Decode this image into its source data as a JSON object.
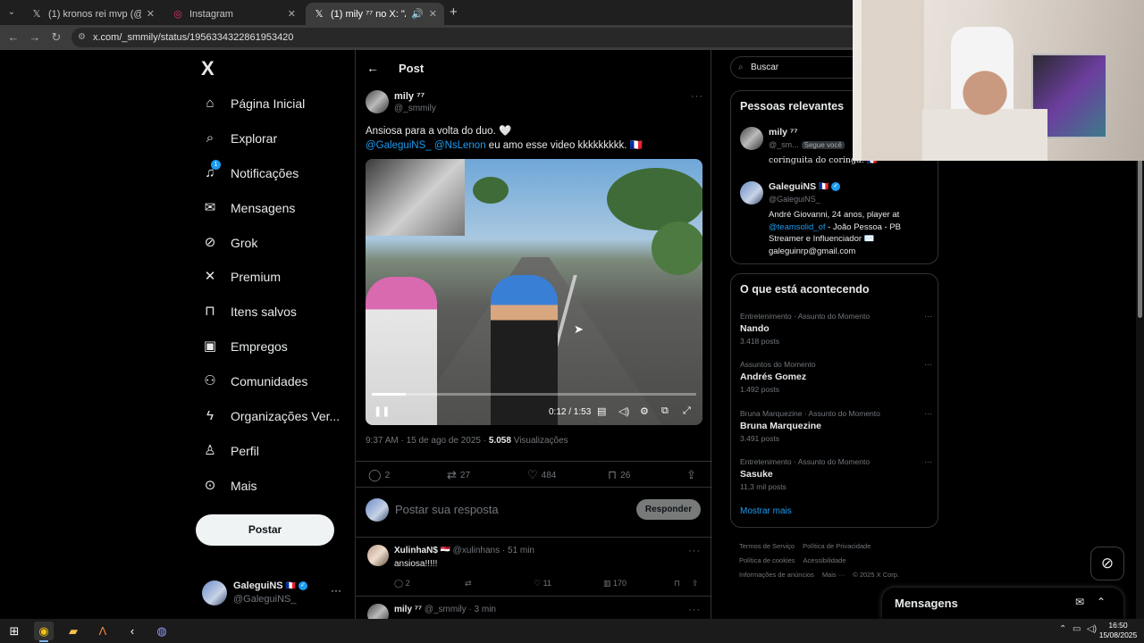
{
  "browser": {
    "tabs": [
      {
        "label": "(1) kronos rei mvp (@KronosxF",
        "icon": "x-logo-icon"
      },
      {
        "label": "Instagram",
        "icon": "instagram-icon"
      },
      {
        "label": "(1) mily ⁷⁷ no X: \"Ansiosa pa",
        "icon": "x-logo-icon",
        "active": true
      }
    ],
    "url": "x.com/_smmily/status/1956334322861953420"
  },
  "nav": {
    "logo": "X",
    "items": [
      {
        "label": "Página Inicial",
        "icon": "home-icon"
      },
      {
        "label": "Explorar",
        "icon": "search-icon"
      },
      {
        "label": "Notificações",
        "icon": "bell-icon",
        "badge": "1"
      },
      {
        "label": "Mensagens",
        "icon": "mail-icon"
      },
      {
        "label": "Grok",
        "icon": "grok-icon"
      },
      {
        "label": "Premium",
        "icon": "x-premium-icon"
      },
      {
        "label": "Itens salvos",
        "icon": "bookmark-icon"
      },
      {
        "label": "Empregos",
        "icon": "briefcase-icon"
      },
      {
        "label": "Comunidades",
        "icon": "people-icon"
      },
      {
        "label": "Organizações Ver...",
        "icon": "lightning-icon"
      },
      {
        "label": "Perfil",
        "icon": "person-icon"
      },
      {
        "label": "Mais",
        "icon": "more-circle-icon"
      }
    ],
    "post_button": "Postar",
    "account": {
      "name": "GaleguiNS",
      "handle": "@GaleguiNS_",
      "flag": "🇫🇷"
    }
  },
  "post": {
    "header_title": "Post",
    "author": {
      "name": "mily ⁷⁷",
      "handle": "@_smmily"
    },
    "text_line1": "Ansiosa para a volta do duo. 🤍",
    "mention1": "@GaleguiNS_",
    "mention2": "@NsLenon",
    "text_line2": " eu amo esse video kkkkkkkkk. 🇫🇷",
    "video": {
      "time": "0:12 / 1:53",
      "progress": 0.106
    },
    "meta_time": "9:37 AM · 15 de ago de 2025 · ",
    "views_count": "5.058",
    "views_label": " Visualizações",
    "stats": {
      "replies": "2",
      "reposts": "27",
      "likes": "484",
      "bookmarks": "26"
    }
  },
  "reply_box": {
    "placeholder": "Postar sua resposta",
    "button": "Responder"
  },
  "replies": [
    {
      "name": "XulinhaN$",
      "flag": "🇪🇬",
      "meta": " @xulinhans · 51 min",
      "text": "ansiosa!!!!!",
      "replies": "2",
      "likes": "11",
      "views": "170"
    },
    {
      "name": "mily ⁷⁷",
      "meta": " @_smmily · 3 min",
      "text": "",
      "replies": "",
      "likes": "",
      "views": ""
    }
  ],
  "sidebar": {
    "search_placeholder": "Buscar",
    "relevant_title": "Pessoas relevantes",
    "people": [
      {
        "name": "mily ⁷⁷",
        "handle": "@_sm...",
        "follows": "Segue você",
        "bio": "coringuita do coringa. 🇫🇷"
      },
      {
        "name": "GaleguiNS",
        "flag": "🇫🇷",
        "handle": "@GaleguiNS_",
        "bio_a": "André Giovanni, 24 anos, player at ",
        "bio_mention": "@teamsolid_of",
        "bio_b": " - João Pessoa - PB Streamer e Influenciador ✉️ galeguinrp@gmail.com"
      }
    ],
    "trending_title": "O que está acontecendo",
    "trends": [
      {
        "context": "Entretenimento · Assunto do Momento",
        "title": "Nando",
        "posts": "3.418 posts"
      },
      {
        "context": "Assuntos do Momento",
        "title": "Andrés Gomez",
        "posts": "1.492 posts"
      },
      {
        "context": "Bruna Marquezine · Assunto do Momento",
        "title": "Bruna Marquezine",
        "posts": "3.491 posts"
      },
      {
        "context": "Entretenimento · Assunto do Momento",
        "title": "Sasuke",
        "posts": "11,3 mil posts"
      }
    ],
    "show_more": "Mostrar mais",
    "footer": [
      "Termos de Serviço",
      "Política de Privacidade",
      "Política de cookies",
      "Acessibilidade",
      "Informações de anúncios",
      "Mais ···",
      "© 2025 X Corp."
    ],
    "messages_title": "Mensagens"
  },
  "taskbar": {
    "time": "16:50",
    "date": "15/08/2025"
  }
}
